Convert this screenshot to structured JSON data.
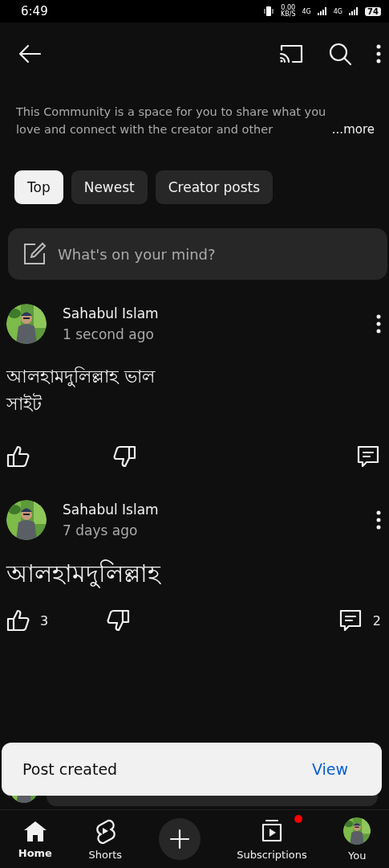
{
  "status_bar": {
    "time": "6:49",
    "net_speed": "0.00",
    "net_unit": "KB/S",
    "signals": [
      "4G",
      "4G"
    ],
    "battery": "74"
  },
  "description": {
    "text": "This Community is a space for you to share what you love and connect with the creator and other",
    "more": "...more"
  },
  "chips": [
    {
      "label": "Top",
      "selected": true
    },
    {
      "label": "Newest",
      "selected": false
    },
    {
      "label": "Creator posts",
      "selected": false
    }
  ],
  "composer": {
    "placeholder": "What's on your mind?"
  },
  "posts": [
    {
      "author": "Sahabul Islam",
      "time": "1 second ago",
      "text": "আলহামদুলিল্লাহ ভাল সাইট"
    },
    {
      "author": "Sahabul Islam",
      "time": "7 days ago",
      "text": "আলহামদুলিল্লাহ",
      "likes": "3",
      "comments": "2",
      "large": true
    }
  ],
  "comment_bar": {
    "kind": "field"
  },
  "toast": {
    "message": "Post created",
    "action": "View"
  },
  "nav": [
    {
      "kind": "home",
      "label": "Home",
      "selected": true
    },
    {
      "kind": "shorts",
      "label": "Shorts",
      "selected": false
    },
    {
      "kind": "create"
    },
    {
      "kind": "subscriptions",
      "label": "Subscriptions",
      "selected": false,
      "badge": true
    },
    {
      "kind": "you",
      "label": "You",
      "selected": false
    }
  ]
}
